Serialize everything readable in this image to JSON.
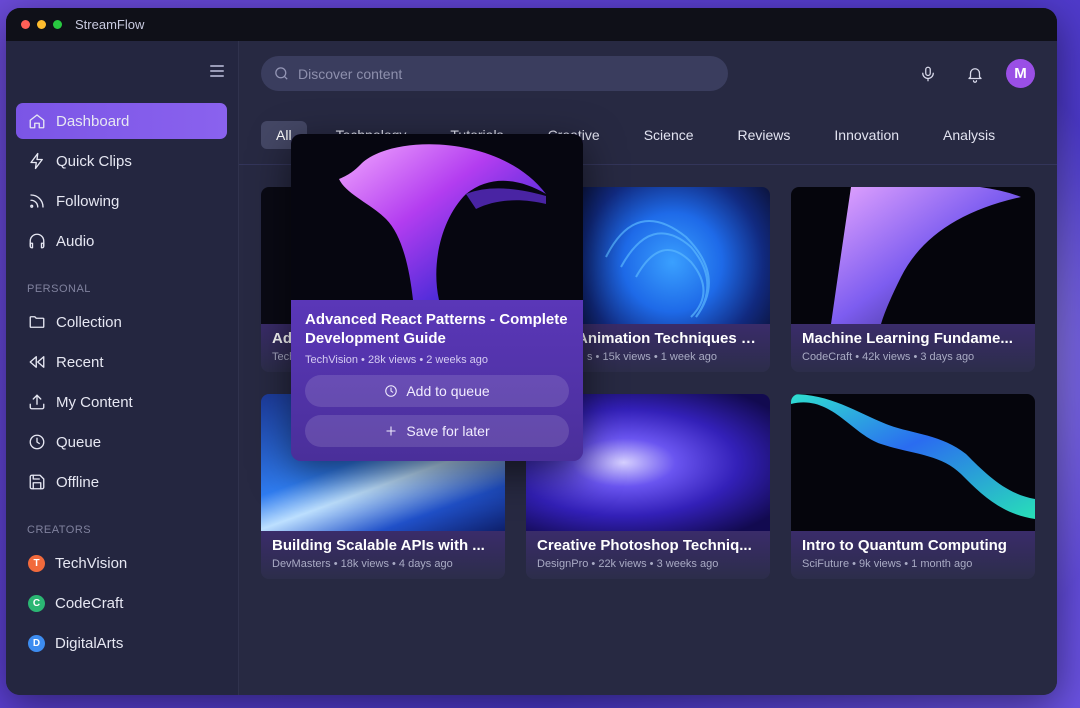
{
  "app": {
    "title": "StreamFlow"
  },
  "sidebar": {
    "main_items": [
      {
        "label": "Dashboard",
        "icon": "home-icon",
        "active": true
      },
      {
        "label": "Quick Clips",
        "icon": "lightning-icon"
      },
      {
        "label": "Following",
        "icon": "rss-icon"
      },
      {
        "label": "Audio",
        "icon": "headphones-icon"
      }
    ],
    "personal_label": "PERSONAL",
    "personal_items": [
      {
        "label": "Collection",
        "icon": "folder-icon"
      },
      {
        "label": "Recent",
        "icon": "rewind-icon"
      },
      {
        "label": "My Content",
        "icon": "upload-icon"
      },
      {
        "label": "Queue",
        "icon": "clock-icon"
      },
      {
        "label": "Offline",
        "icon": "save-icon"
      }
    ],
    "creators_label": "CREATORS",
    "creators": [
      {
        "initial": "T",
        "name": "TechVision",
        "color": "#f26a3c"
      },
      {
        "initial": "C",
        "name": "CodeCraft",
        "color": "#2bb673"
      },
      {
        "initial": "D",
        "name": "DigitalArts",
        "color": "#3d8cf0"
      }
    ]
  },
  "header": {
    "search_placeholder": "Discover content",
    "avatar_initial": "M"
  },
  "categories": [
    "All",
    "Technology",
    "Tutorials",
    "Creative",
    "Science",
    "Reviews",
    "Innovation",
    "Analysis"
  ],
  "videos": [
    {
      "title": "Advanced React Patterns - Complete Development Guide",
      "short": "Adv",
      "meta": "TechV",
      "hidden": true
    },
    {
      "title": "Animation Techniques w...",
      "meta": "s • 15k views • 1 week ago"
    },
    {
      "title": "Machine Learning Fundame...",
      "meta": "CodeCraft • 42k views • 3 days ago"
    },
    {
      "title": "Building Scalable APIs with ...",
      "meta": "DevMasters • 18k views • 4 days ago"
    },
    {
      "title": "Creative Photoshop Techniq...",
      "meta": "DesignPro • 22k views • 3 weeks ago"
    },
    {
      "title": "Intro to Quantum Computing",
      "meta": "SciFuture • 9k views • 1 month ago"
    }
  ],
  "popup": {
    "title": "Advanced React Patterns - Complete Development Guide",
    "meta": "TechVision • 28k views • 2 weeks ago",
    "queue_label": "Add to queue",
    "save_label": "Save for later"
  }
}
